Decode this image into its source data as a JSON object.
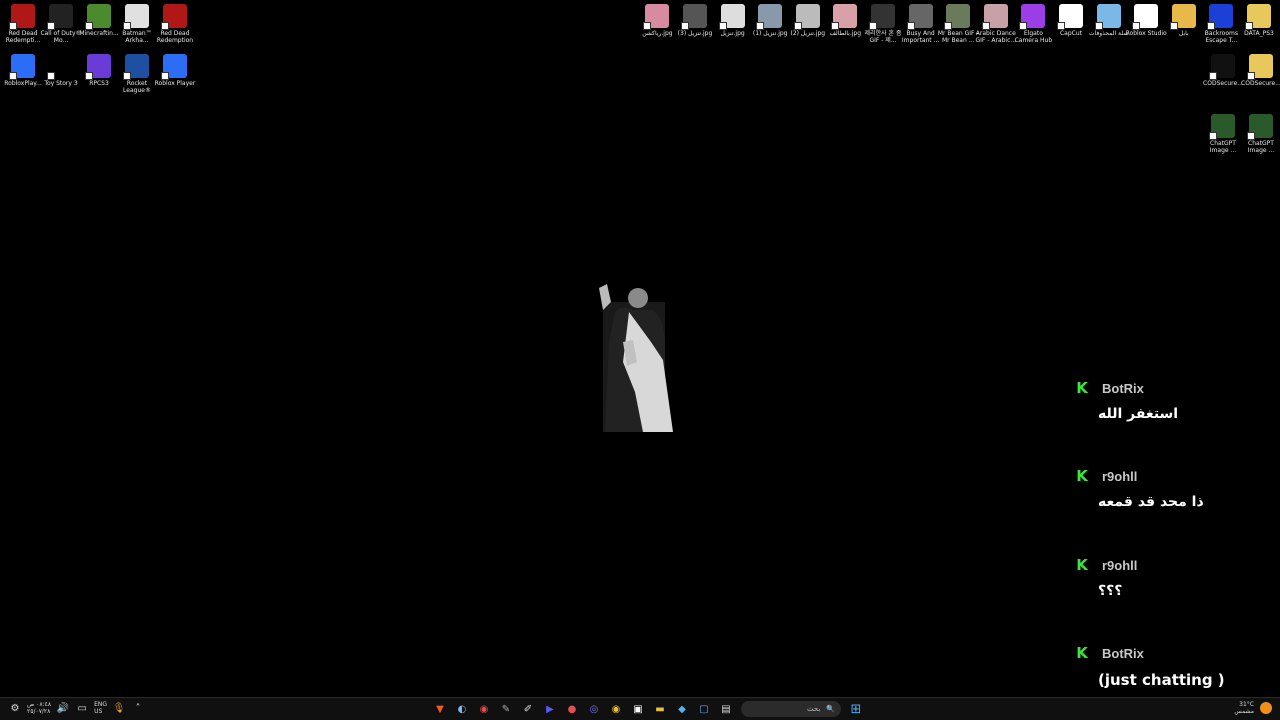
{
  "desktop": {
    "left_icons": [
      {
        "label": "Red Dead Redempti...",
        "icon": "rdr-icon",
        "color": "#b01818"
      },
      {
        "label": "Call of Duty® Mo...",
        "icon": "mw-icon",
        "color": "#222222"
      },
      {
        "label": "Minecraftin...",
        "icon": "minecraft-icon",
        "color": "#4c8a2e"
      },
      {
        "label": "Batman™ Arkha...",
        "icon": "batman-icon",
        "color": "#e0e0e0"
      },
      {
        "label": "Red Dead Redemption",
        "icon": "rdr-icon",
        "color": "#b01818"
      },
      {
        "label": "RobloxPlay...",
        "icon": "roblox-icon",
        "color": "#2b6ef5"
      },
      {
        "label": "Toy Story 3",
        "icon": "toy-story-icon",
        "color": "#000000"
      },
      {
        "label": "RPCS3",
        "icon": "rpcs3-icon",
        "color": "#6a3bd6"
      },
      {
        "label": "Rocket League®",
        "icon": "rocket-league-icon",
        "color": "#1e4fa0"
      },
      {
        "label": "Roblox Player",
        "icon": "roblox-icon",
        "color": "#2b6ef5"
      }
    ],
    "right_icons_row1": [
      {
        "label": "رياكشن.jpg",
        "icon": "image-icon",
        "color": "#d88aa0"
      },
      {
        "label": "تنزيل (3).jpg",
        "icon": "image-icon",
        "color": "#555555"
      },
      {
        "label": "تنزيل.jpg",
        "icon": "image-icon",
        "color": "#dddddd"
      },
      {
        "label": "تنزيل (1).jpg",
        "icon": "image-icon",
        "color": "#8899aa"
      },
      {
        "label": "تنزيل (2).jpg",
        "icon": "image-icon",
        "color": "#bbbbbb"
      },
      {
        "label": "بالطالف.jpg",
        "icon": "image-icon",
        "color": "#d8a0a8"
      },
      {
        "label": "제리한사 혼 좀 GIF - 제...",
        "icon": "gif-icon",
        "color": "#333333"
      },
      {
        "label": "Busy And Important ...",
        "icon": "gif-icon",
        "color": "#666666"
      },
      {
        "label": "Mr Bean GIF - Mr Bean ...",
        "icon": "gif-icon",
        "color": "#6a7a5a"
      },
      {
        "label": "Arabic Dance GIF - Arabic...",
        "icon": "gif-icon",
        "color": "#c8a0a8"
      },
      {
        "label": "Elgato Camera Hub",
        "icon": "elgato-icon",
        "color": "#9b3ee8"
      },
      {
        "label": "CapCut",
        "icon": "capcut-icon",
        "color": "#ffffff"
      },
      {
        "label": "سلة المحذوفات",
        "icon": "recycle-bin-icon",
        "color": "#7ab8e8"
      },
      {
        "label": "Roblox Studio",
        "icon": "roblox-studio-icon",
        "color": "#ffffff"
      },
      {
        "label": "بابل",
        "icon": "folder-icon",
        "color": "#e8b84a"
      },
      {
        "label": "Backrooms Escape T...",
        "icon": "backrooms-icon",
        "color": "#1a40d8"
      },
      {
        "label": "DATA_PS3",
        "icon": "folder-icon",
        "color": "#e8c85a"
      }
    ],
    "right_icons_row2": [
      {
        "label": "CODSecure...",
        "icon": "cod-icon",
        "color": "#111111"
      },
      {
        "label": "CODSecure...",
        "icon": "folder-icon",
        "color": "#e8c85a"
      }
    ],
    "right_icons_row3": [
      {
        "label": "ChatGPT Image ...",
        "icon": "image-icon",
        "color": "#2a5a2a"
      },
      {
        "label": "ChatGPT Image ...",
        "icon": "image-icon",
        "color": "#2a5a2a"
      }
    ]
  },
  "chat": {
    "badge": "K",
    "badge_color": "#39e639",
    "messages": [
      {
        "user": "BotRix",
        "text": "استغفر الله"
      },
      {
        "user": "r9ohll",
        "text": "ذا محد قد قمعه"
      },
      {
        "user": "r9ohll",
        "text": "؟؟؟"
      },
      {
        "user": "BotRix",
        "text": "(just chatting )"
      }
    ]
  },
  "taskbar": {
    "clock_time": "٠٨:٤٨ ص",
    "clock_date": "٢٥/٠٧/٢٨",
    "lang": "ENG",
    "lang_sub": "US",
    "search_placeholder": "بحث",
    "weather_temp": "31°C",
    "weather_desc": "مشمس"
  }
}
